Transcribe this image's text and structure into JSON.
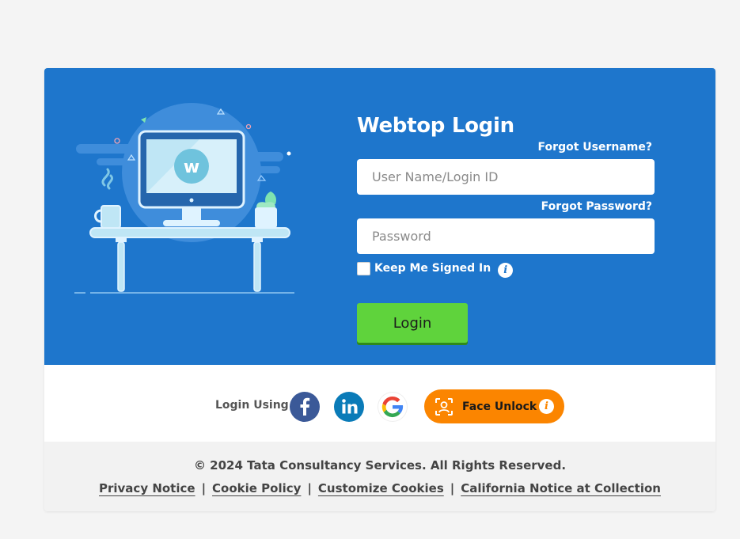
{
  "login": {
    "title": "Webtop Login",
    "forgot_username": "Forgot Username?",
    "username_placeholder": "User Name/Login ID",
    "forgot_password": "Forgot Password?",
    "password_placeholder": "Password",
    "keep_signed_in": "Keep Me Signed In",
    "keep_signed_in_checked": false,
    "login_button": "Login"
  },
  "social": {
    "label": "Login Using",
    "providers": [
      "facebook-icon",
      "linkedin-icon",
      "google-icon"
    ],
    "face_unlock": "Face Unlock"
  },
  "footer": {
    "copyright": "© 2024 Tata Consultancy Services. All Rights Reserved.",
    "links": [
      "Privacy Notice",
      "Cookie Policy",
      "Customize Cookies",
      "California Notice at Collection"
    ],
    "separator": "|"
  },
  "colors": {
    "hero_blue": "#1e76cc",
    "login_green": "#5fd33c",
    "face_orange": "#fb8500",
    "facebook": "#3b5998",
    "linkedin": "#0a7bb8"
  }
}
